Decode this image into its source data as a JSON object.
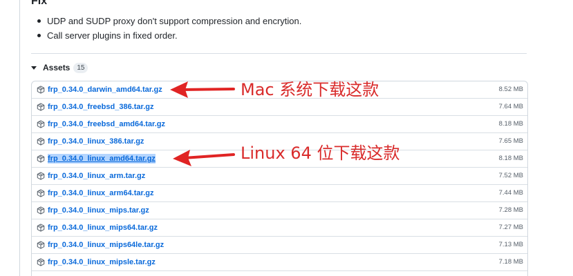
{
  "release_notes": {
    "fix_heading": "Fix",
    "fix_items": [
      "UDP and SUDP proxy don't support compression and encrytion.",
      "Call server plugins in fixed order."
    ]
  },
  "assets": {
    "title": "Assets",
    "count": "15",
    "files": [
      {
        "name": "frp_0.34.0_darwin_amd64.tar.gz",
        "size": "8.52 MB"
      },
      {
        "name": "frp_0.34.0_freebsd_386.tar.gz",
        "size": "7.64 MB"
      },
      {
        "name": "frp_0.34.0_freebsd_amd64.tar.gz",
        "size": "8.18 MB"
      },
      {
        "name": "frp_0.34.0_linux_386.tar.gz",
        "size": "7.65 MB"
      },
      {
        "name": "frp_0.34.0_linux_amd64.tar.gz",
        "size": "8.18 MB"
      },
      {
        "name": "frp_0.34.0_linux_arm.tar.gz",
        "size": "7.52 MB"
      },
      {
        "name": "frp_0.34.0_linux_arm64.tar.gz",
        "size": "7.44 MB"
      },
      {
        "name": "frp_0.34.0_linux_mips.tar.gz",
        "size": "7.28 MB"
      },
      {
        "name": "frp_0.34.0_linux_mips64.tar.gz",
        "size": "7.27 MB"
      },
      {
        "name": "frp_0.34.0_linux_mips64le.tar.gz",
        "size": "7.13 MB"
      },
      {
        "name": "frp_0.34.0_linux_mipsle.tar.gz",
        "size": "7.18 MB"
      }
    ],
    "selected_file": "frp_0.34.0_linux_amd64.tar.gz"
  },
  "annotations": {
    "mac": "Mac 系统下载这款",
    "linux": "Linux 64 位下载这款"
  },
  "colors": {
    "link": "#0969da",
    "annotation": "#d92b2b",
    "selection": "#b4d5fe"
  },
  "icons": {
    "asset": "package-icon",
    "toggle": "caret-down-icon",
    "annotation_pointer": "arrow-left-icon"
  }
}
